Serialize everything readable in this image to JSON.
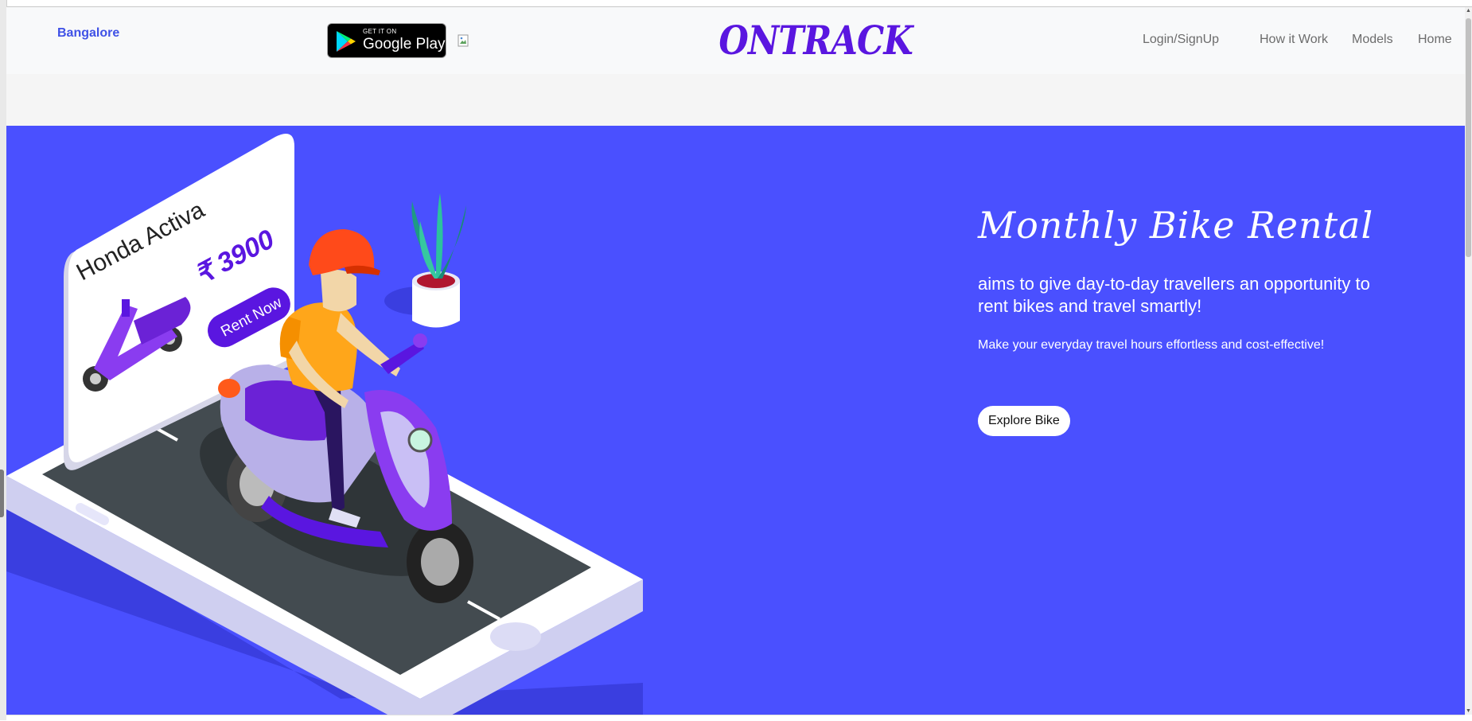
{
  "navbar": {
    "city": "Bangalore",
    "google_play": {
      "small_text": "GET IT ON",
      "big_text": "Google Play"
    },
    "brand": "ONTRACK",
    "links": [
      "Login/SignUp",
      "How it Work",
      "Models",
      "Home"
    ]
  },
  "hero": {
    "title": "Monthly Bike Rental",
    "subtitle": "aims to give day-to-day travellers an opportunity to rent bikes and travel smartly!",
    "description": "Make your everyday travel hours effortless and cost-effective!",
    "button": "Explore Bike",
    "illustration": {
      "card_model": "Honda Activa",
      "card_price": "₹ 3900",
      "card_button": "Rent Now"
    }
  },
  "colors": {
    "hero_bg": "#4a50ff",
    "brand": "#5a16e0",
    "city_link": "#3f51e6",
    "navbar_bg": "#f8f9fa"
  }
}
